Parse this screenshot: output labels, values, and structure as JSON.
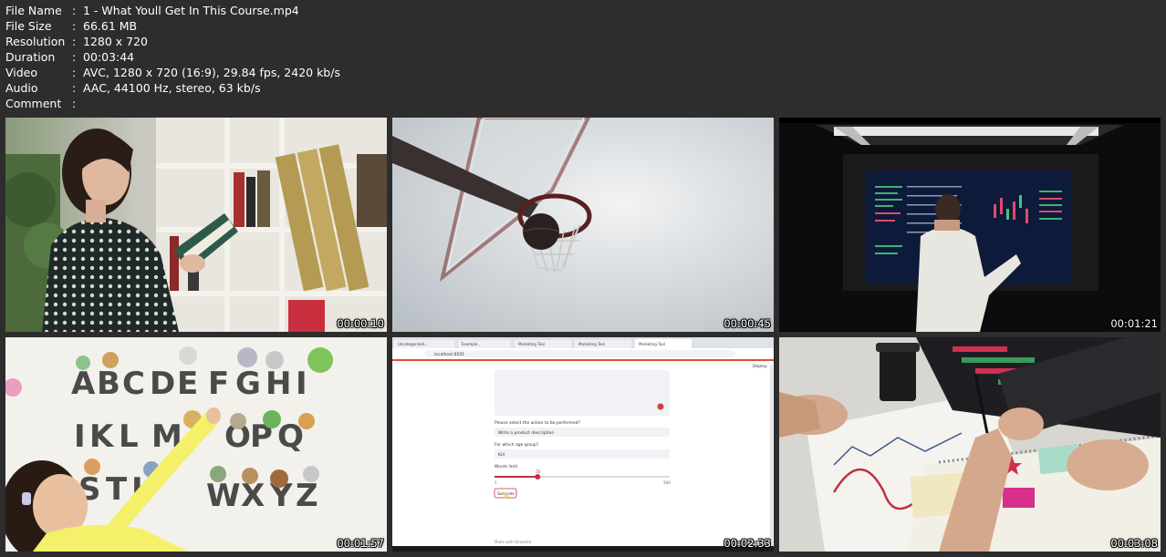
{
  "file_info": [
    {
      "label": "File Name",
      "value": "1 - What Youll Get In This Course.mp4"
    },
    {
      "label": "File Size",
      "value": "66.61 MB"
    },
    {
      "label": "Resolution",
      "value": "1280 x 720"
    },
    {
      "label": "Duration",
      "value": "00:03:44"
    },
    {
      "label": "Video",
      "value": "AVC, 1280 x 720 (16:9), 29.84 fps, 2420 kb/s"
    },
    {
      "label": "Audio",
      "value": "AAC, 44100 Hz, stereo, 63 kb/s"
    },
    {
      "label": "Comment",
      "value": ""
    }
  ],
  "separator": ":",
  "thumbnails": [
    {
      "timestamp": "00:00:10",
      "scene": "woman-reading-bookshelf"
    },
    {
      "timestamp": "00:00:45",
      "scene": "basketball-hoop-sky"
    },
    {
      "timestamp": "00:01:21",
      "scene": "man-trading-screen"
    },
    {
      "timestamp": "00:01:57",
      "scene": "child-alphabet-wall"
    },
    {
      "timestamp": "00:02:33",
      "scene": "browser-marketing-tool"
    },
    {
      "timestamp": "00:03:08",
      "scene": "hands-drawing-charts"
    }
  ],
  "browser_frame": {
    "tabs": [
      "Uncategorized...",
      "Example...",
      "Marketing Tool",
      "Marketing Tool",
      "Marketing Tool"
    ],
    "url": "localhost:8501",
    "deploy": "Deploy",
    "action_label": "Please select the action to be performed?",
    "action_value": "Write a product description",
    "age_label": "For which age group?",
    "age_value": "Kid",
    "words_label": "Words limit",
    "slider_value": "50",
    "slider_min": "1",
    "slider_max": "200",
    "button": "Generate",
    "footer": "Made with Streamlit"
  }
}
